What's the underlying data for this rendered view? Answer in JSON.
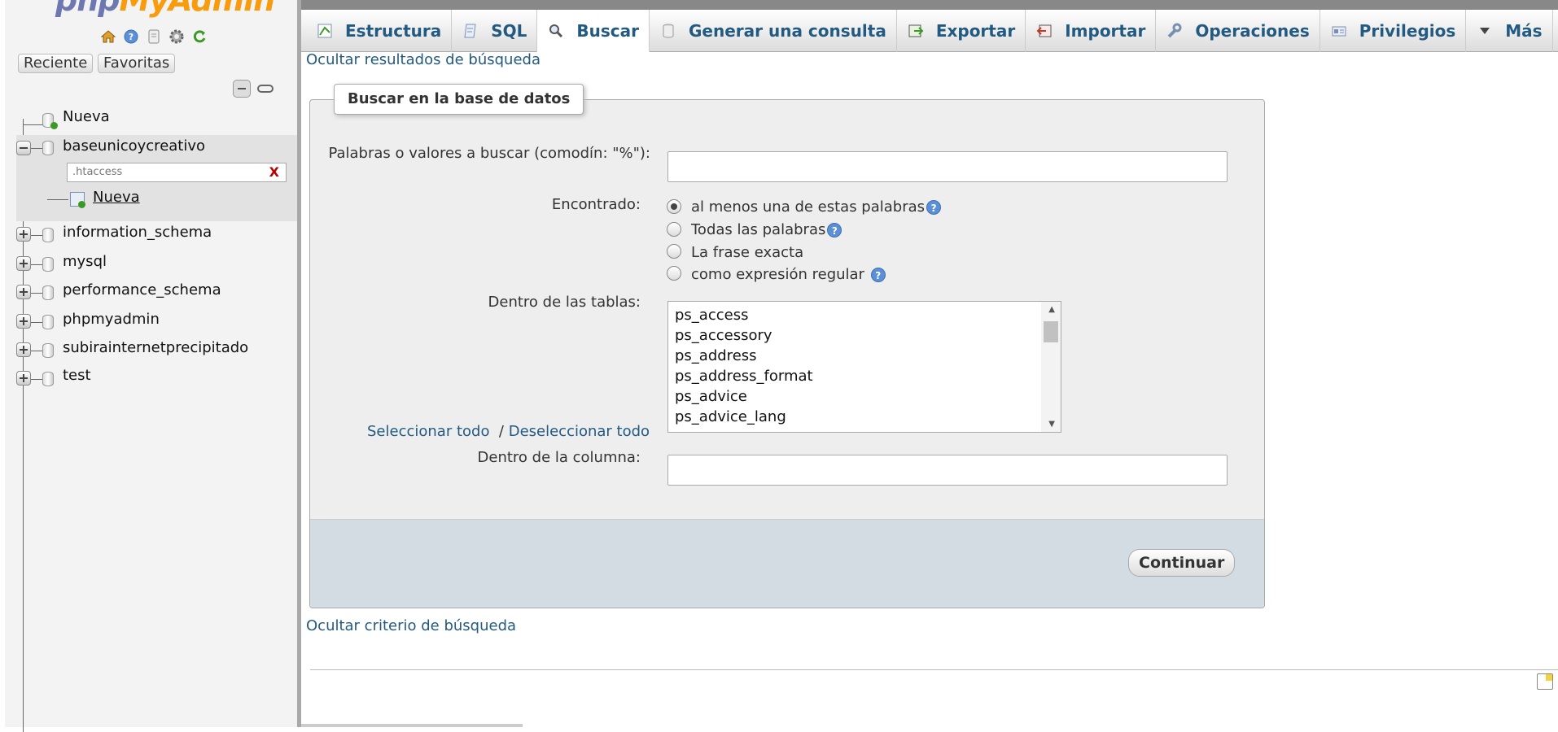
{
  "app": {
    "logo_left": "php",
    "logo_right": "MyAdmin",
    "colors": {
      "link": "#235a81",
      "panel_bg": "#eeeeee",
      "footer_band": "#d3dce3",
      "sidebar_bg": "#f3f3f3"
    }
  },
  "sidebar": {
    "nav_icons": [
      "home-icon",
      "help-icon",
      "docs-icon",
      "settings-icon",
      "reload-icon"
    ],
    "recent_label": "Reciente",
    "favorites_label": "Favoritas",
    "new_label": "Nueva",
    "databases": [
      {
        "name": "baseunicoycreativo",
        "expanded": true
      },
      {
        "name": "information_schema"
      },
      {
        "name": "mysql"
      },
      {
        "name": "performance_schema"
      },
      {
        "name": "phpmyadmin"
      },
      {
        "name": "subirainternetprecipitado"
      },
      {
        "name": "test"
      }
    ],
    "table_filter_placeholder": ".htaccess",
    "table_filter_clear": "X",
    "new_table_label": "Nueva"
  },
  "tabs": [
    {
      "label": "Estructura",
      "icon": "structure-icon"
    },
    {
      "label": "SQL",
      "icon": "sql-icon"
    },
    {
      "label": "Buscar",
      "icon": "search-icon",
      "active": true
    },
    {
      "label": "Generar una consulta",
      "icon": "query-icon"
    },
    {
      "label": "Exportar",
      "icon": "export-icon"
    },
    {
      "label": "Importar",
      "icon": "import-icon"
    },
    {
      "label": "Operaciones",
      "icon": "wrench-icon"
    },
    {
      "label": "Privilegios",
      "icon": "privileges-icon"
    },
    {
      "label": "Más",
      "icon": "caret-down-icon"
    }
  ],
  "main": {
    "hide_results_link": "Ocultar resultados de búsqueda",
    "form_title": "Buscar en la base de datos",
    "search_words_label": "Palabras o valores a buscar (comodín: \"%\"):",
    "search_words_value": "",
    "found_label": "Encontrado:",
    "options": [
      {
        "label": "al menos una de estas palabras",
        "checked": true,
        "help": true
      },
      {
        "label": "Todas las palabras",
        "checked": false,
        "help": true
      },
      {
        "label": "La frase exacta",
        "checked": false,
        "help": false
      },
      {
        "label": "como expresión regular",
        "checked": false,
        "help": true
      }
    ],
    "help_glyph": "?",
    "tables_label": "Dentro de las tablas:",
    "tables": [
      "ps_access",
      "ps_accessory",
      "ps_address",
      "ps_address_format",
      "ps_advice",
      "ps_advice_lang"
    ],
    "select_all": "Seleccionar todo",
    "separator": "/",
    "deselect_all": "Deseleccionar todo",
    "column_label": "Dentro de la columna:",
    "column_value": "",
    "continue_button": "Continuar",
    "hide_criteria_link": "Ocultar criterio de búsqueda"
  }
}
